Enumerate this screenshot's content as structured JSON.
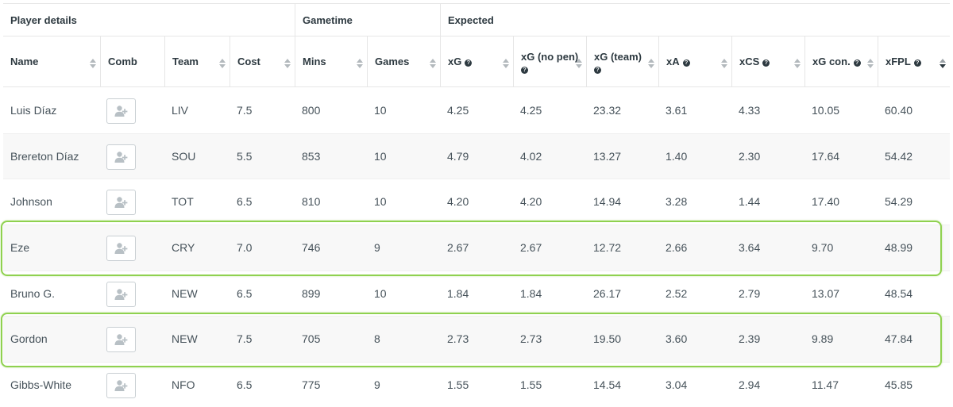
{
  "groups": {
    "player_details": "Player details",
    "gametime": "Gametime",
    "expected": "Expected"
  },
  "columns": {
    "name": "Name",
    "comb": "Comb",
    "team": "Team",
    "cost": "Cost",
    "mins": "Mins",
    "games": "Games",
    "xg": "xG",
    "xg_nopen": "xG (no pen)",
    "xg_team": "xG (team)",
    "xa": "xA",
    "xcs": "xCS",
    "xg_con": "xG con.",
    "xfpl": "xFPL"
  },
  "sort": {
    "column": "xFPL",
    "direction": "descending"
  },
  "icons": {
    "help": "question-circle-icon",
    "comb": "add-user-icon",
    "sort": "sort-arrows-icon"
  },
  "highlight_color": "#8fd14f",
  "players": [
    {
      "name": "Luis Díaz",
      "team": "LIV",
      "cost": "7.5",
      "mins": "800",
      "games": "10",
      "xg": "4.25",
      "xg_nopen": "4.25",
      "xg_team": "23.32",
      "xa": "3.61",
      "xcs": "4.33",
      "xg_con": "10.05",
      "xfpl": "60.40",
      "highlighted": false
    },
    {
      "name": "Brereton Díaz",
      "team": "SOU",
      "cost": "5.5",
      "mins": "853",
      "games": "10",
      "xg": "4.79",
      "xg_nopen": "4.02",
      "xg_team": "13.27",
      "xa": "1.40",
      "xcs": "2.30",
      "xg_con": "17.64",
      "xfpl": "54.42",
      "highlighted": false
    },
    {
      "name": "Johnson",
      "team": "TOT",
      "cost": "6.5",
      "mins": "810",
      "games": "10",
      "xg": "4.20",
      "xg_nopen": "4.20",
      "xg_team": "14.94",
      "xa": "3.28",
      "xcs": "1.44",
      "xg_con": "17.40",
      "xfpl": "54.29",
      "highlighted": false
    },
    {
      "name": "Eze",
      "team": "CRY",
      "cost": "7.0",
      "mins": "746",
      "games": "9",
      "xg": "2.67",
      "xg_nopen": "2.67",
      "xg_team": "12.72",
      "xa": "2.66",
      "xcs": "3.64",
      "xg_con": "9.70",
      "xfpl": "48.99",
      "highlighted": true
    },
    {
      "name": "Bruno G.",
      "team": "NEW",
      "cost": "6.5",
      "mins": "899",
      "games": "10",
      "xg": "1.84",
      "xg_nopen": "1.84",
      "xg_team": "26.17",
      "xa": "2.52",
      "xcs": "2.79",
      "xg_con": "13.07",
      "xfpl": "48.54",
      "highlighted": false
    },
    {
      "name": "Gordon",
      "team": "NEW",
      "cost": "7.5",
      "mins": "705",
      "games": "8",
      "xg": "2.73",
      "xg_nopen": "2.73",
      "xg_team": "19.50",
      "xa": "3.60",
      "xcs": "2.39",
      "xg_con": "9.89",
      "xfpl": "47.84",
      "highlighted": true
    },
    {
      "name": "Gibbs-White",
      "team": "NFO",
      "cost": "6.5",
      "mins": "775",
      "games": "9",
      "xg": "1.55",
      "xg_nopen": "1.55",
      "xg_team": "14.54",
      "xa": "3.04",
      "xcs": "2.94",
      "xg_con": "11.47",
      "xfpl": "45.85",
      "highlighted": false
    }
  ]
}
